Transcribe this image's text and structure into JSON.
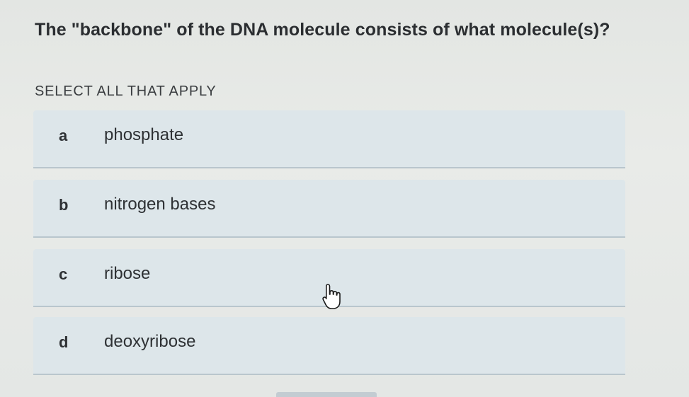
{
  "question": {
    "text": "The \"backbone\" of the DNA molecule consists of what molecule(s)?"
  },
  "instruction": "SELECT ALL THAT APPLY",
  "options": [
    {
      "letter": "a",
      "text": "phosphate"
    },
    {
      "letter": "b",
      "text": "nitrogen bases"
    },
    {
      "letter": "c",
      "text": "ribose"
    },
    {
      "letter": "d",
      "text": "deoxyribose"
    }
  ],
  "cursor": {
    "icon": "hand-pointer-icon"
  },
  "colors": {
    "background": "#e6e9e6",
    "option_background": "#dde6ea",
    "option_border": "#b9c6cd",
    "text": "#2e3134"
  }
}
